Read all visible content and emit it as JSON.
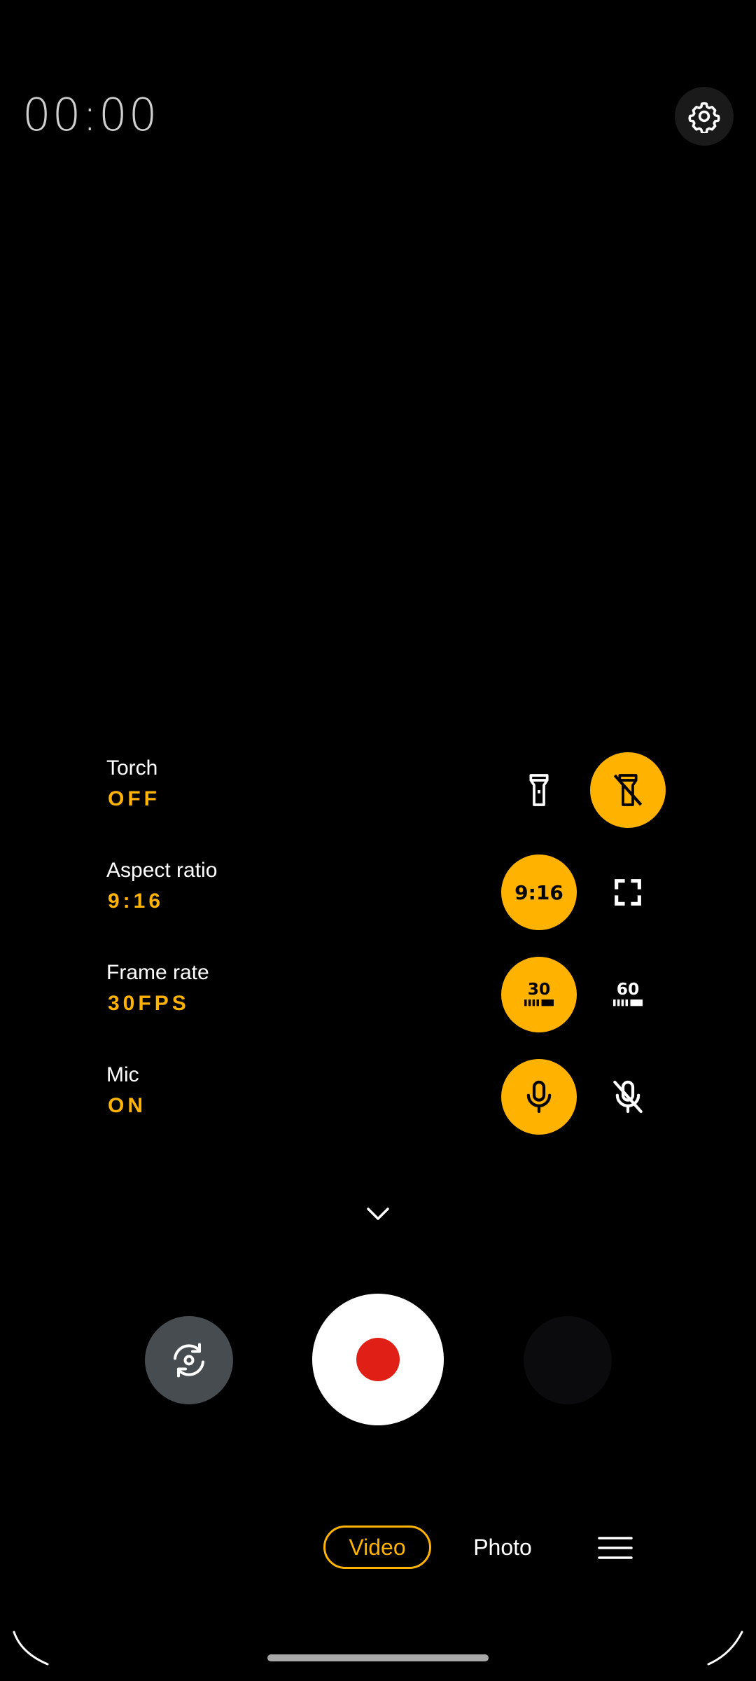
{
  "timer": "00:00",
  "settings": [
    {
      "label": "Torch",
      "value": "OFF"
    },
    {
      "label": "Aspect ratio",
      "value": "9:16",
      "option_a_text": "9:16"
    },
    {
      "label": "Frame rate",
      "value": "30FPS",
      "option_a_text": "30",
      "option_b_text": "60"
    },
    {
      "label": "Mic",
      "value": "ON"
    }
  ],
  "modes": {
    "video": "Video",
    "photo": "Photo",
    "selected": "Video"
  },
  "colors": {
    "accent": "#ffb300",
    "record": "#e02016",
    "background": "#000000"
  },
  "icons": {
    "settings": "gear-icon",
    "torch_on": "flashlight-icon",
    "torch_off": "flashlight-off-icon",
    "fullscreen": "fullscreen-icon",
    "mic_on": "mic-icon",
    "mic_off": "mic-off-icon",
    "collapse": "chevron-down-icon",
    "switch_camera": "switch-camera-icon",
    "menu": "hamburger-menu-icon"
  }
}
